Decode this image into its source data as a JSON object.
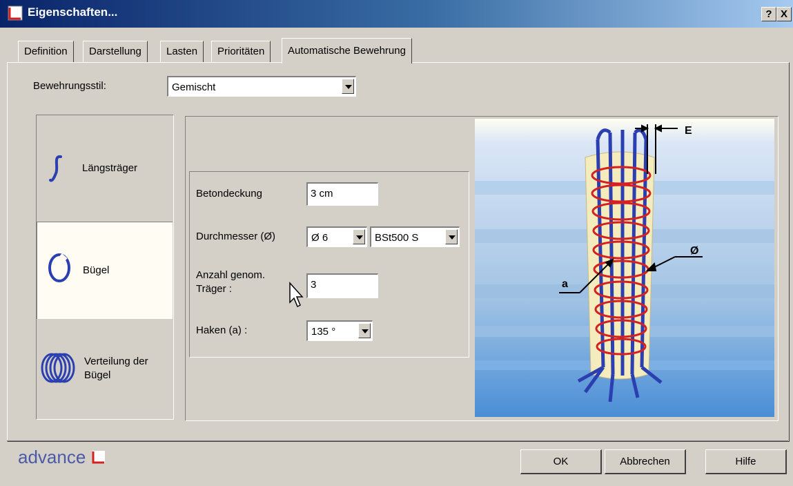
{
  "window": {
    "title": "Eigenschaften...",
    "help_label": "?",
    "close_label": "X"
  },
  "tabs": [
    {
      "label": "Definition"
    },
    {
      "label": "Darstellung"
    },
    {
      "label": "Lasten"
    },
    {
      "label": "Prioritäten"
    },
    {
      "label": "Automatische Bewehrung",
      "active": true
    }
  ],
  "style_row": {
    "label": "Bewehrungsstil:",
    "value": "Gemischt"
  },
  "sidebar": {
    "items": [
      {
        "label": "Längsträger",
        "icon": "longitudinal-bar-icon"
      },
      {
        "label": "Bügel",
        "icon": "stirrup-icon",
        "selected": true
      },
      {
        "label_line1": "Verteilung der",
        "label_line2": "Bügel",
        "icon": "stirrup-distribution-icon"
      }
    ]
  },
  "form": {
    "cover": {
      "label": "Betondeckung",
      "value": "3 cm"
    },
    "diameter": {
      "label": "Durchmesser (Ø)",
      "value": "Ø 6",
      "steel": "BSt500 S"
    },
    "count": {
      "label_line1": "Anzahl genom.",
      "label_line2": "Träger :",
      "value": "3"
    },
    "hook": {
      "label": "Haken (a) :",
      "value": "135 °"
    }
  },
  "diagram": {
    "label_e": "E",
    "label_diameter": "Ø",
    "label_a": "a"
  },
  "footer": {
    "logo": "advance",
    "ok": "OK",
    "cancel": "Abbrechen",
    "help": "Hilfe"
  },
  "colors": {
    "title_start": "#0a246a",
    "title_end": "#a6caf0",
    "face": "#d4d0c8",
    "rebar_blue": "#2b3fb0",
    "stirrup_red": "#d42020"
  }
}
